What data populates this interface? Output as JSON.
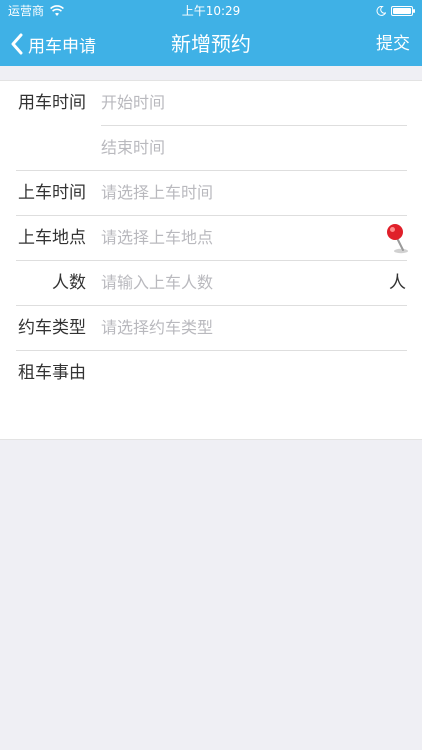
{
  "status_bar": {
    "carrier": "运营商",
    "time": "上午10:29"
  },
  "navbar": {
    "back_label": "用车申请",
    "title": "新增预约",
    "submit_label": "提交"
  },
  "form": {
    "use_time": {
      "label": "用车时间",
      "start_placeholder": "开始时间",
      "end_placeholder": "结束时间"
    },
    "pickup_time": {
      "label": "上车时间",
      "placeholder": "请选择上车时间"
    },
    "pickup_location": {
      "label": "上车地点",
      "placeholder": "请选择上车地点",
      "icon": "map-pin-icon"
    },
    "passengers": {
      "label": "人数",
      "placeholder": "请输入上车人数",
      "unit": "人"
    },
    "car_type": {
      "label": "约车类型",
      "placeholder": "请选择约车类型"
    },
    "reason": {
      "label": "租车事由",
      "placeholder": ""
    }
  },
  "colors": {
    "header": "#3fb1e6",
    "placeholder": "#b9b9be",
    "background": "#efeff4",
    "pin": "#e0202a"
  }
}
